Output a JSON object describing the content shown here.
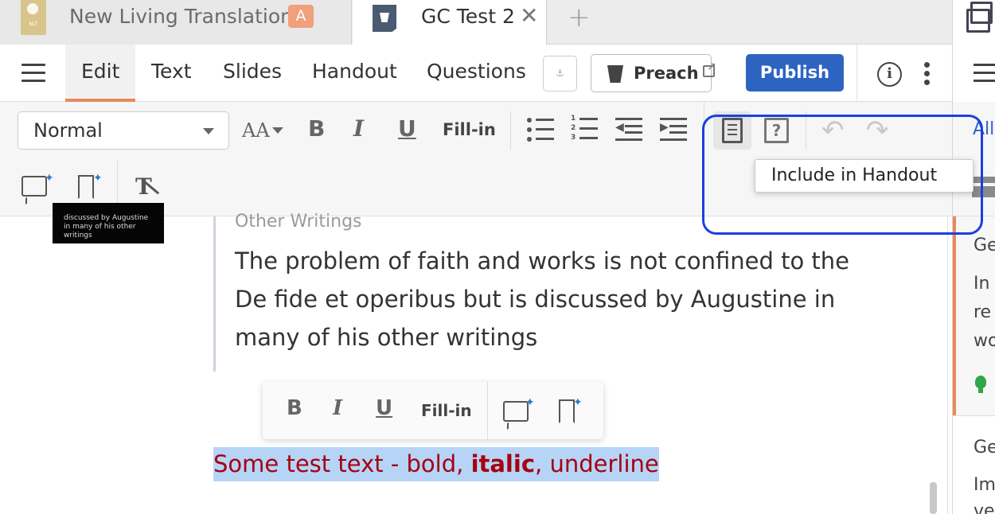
{
  "tabs": [
    {
      "title": "New Living Translation",
      "icon_text": "NLT",
      "badge": "A"
    },
    {
      "title": "GC Test 2",
      "close": "✕"
    }
  ],
  "new_tab": "+",
  "toolbar": {
    "nav": [
      "Edit",
      "Text",
      "Slides",
      "Handout",
      "Questions"
    ],
    "active_nav": "Edit",
    "anchor_label": "⚓",
    "preach_label": "Preach",
    "publish_label": "Publish",
    "info_icon": "i"
  },
  "format_bar": {
    "paragraph_style": "Normal",
    "font_size_icon": "AA",
    "bold": "B",
    "italic": "I",
    "underline": "U",
    "fill_in": "Fill-in",
    "question_icon": "?",
    "undo": "↶",
    "redo": "↷",
    "clear_format": "T"
  },
  "tooltip": "Include in Handout",
  "document": {
    "thumbnail_text": "discussed by Augustine in many of his other writings",
    "section_label": "Other Writings",
    "quote": "The problem of faith and works is not confined to the De fide et operibus but is discussed by Augustine in many of his other writings",
    "floating_toolbar": {
      "bold": "B",
      "italic": "I",
      "underline": "U",
      "fill_in": "Fill-in"
    },
    "selected_text": {
      "before": "Some test text - bold, ",
      "bold_italic": "italic",
      "after": ", underline"
    }
  },
  "right_panel": {
    "filter_label": "All",
    "card1_title": "Ge",
    "card1_lines": [
      "In",
      "re",
      "wo"
    ],
    "card2_title": "Ge",
    "card2_lines": [
      "Im",
      "ve"
    ]
  },
  "colors": {
    "accent": "#e8895a",
    "publish": "#2d64c2",
    "highlight_box": "#1c3fe0",
    "selection_bg": "#b6d4f6",
    "selection_text": "#a50010"
  }
}
